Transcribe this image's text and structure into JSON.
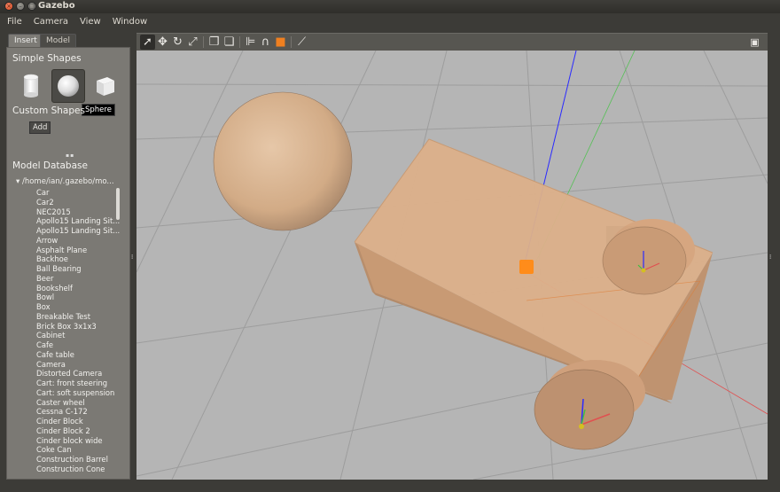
{
  "window": {
    "title": "Gazebo"
  },
  "menu": [
    "File",
    "Camera",
    "View",
    "Window"
  ],
  "tabs": {
    "insert": "Insert",
    "model": "Model"
  },
  "insert": {
    "simple_shapes_heading": "Simple Shapes",
    "tooltip": "Sphere",
    "custom_shapes_heading": "Custom Shapes",
    "add_label": "Add",
    "model_database_heading": "Model Database",
    "tree_root": "/home/ian/.gazebo/mo...",
    "models": [
      "Car",
      "Car2",
      "NEC2015",
      "Apollo15 Landing Sit...",
      "Apollo15 Landing Sit...",
      "Arrow",
      "Asphalt Plane",
      "Backhoe",
      "Ball Bearing",
      "Beer",
      "Bookshelf",
      "Bowl",
      "Box",
      "Breakable Test",
      "Brick Box 3x1x3",
      "Cabinet",
      "Cafe",
      "Cafe table",
      "Camera",
      "Distorted Camera",
      "Cart: front steering",
      "Cart: soft suspension",
      "Caster wheel",
      "Cessna C-172",
      "Cinder Block",
      "Cinder Block 2",
      "Cinder block wide",
      "Coke Can",
      "Construction Barrel",
      "Construction Cone"
    ]
  },
  "toolbar": {
    "icons": [
      "select-arrow-icon",
      "translate-icon",
      "rotate-icon",
      "scale-icon",
      "copy-icon",
      "paste-icon",
      "align-icon",
      "snap-icon",
      "change-view-icon",
      "measure-icon",
      "screenshot-icon"
    ]
  },
  "colors": {
    "viewport_bg": "#b5b5b5",
    "model_body": "#d7ab84",
    "axis_x": "#e04040",
    "axis_y": "#40c040",
    "axis_z": "#2020ff",
    "selection_handle": "#ff8c1a"
  }
}
